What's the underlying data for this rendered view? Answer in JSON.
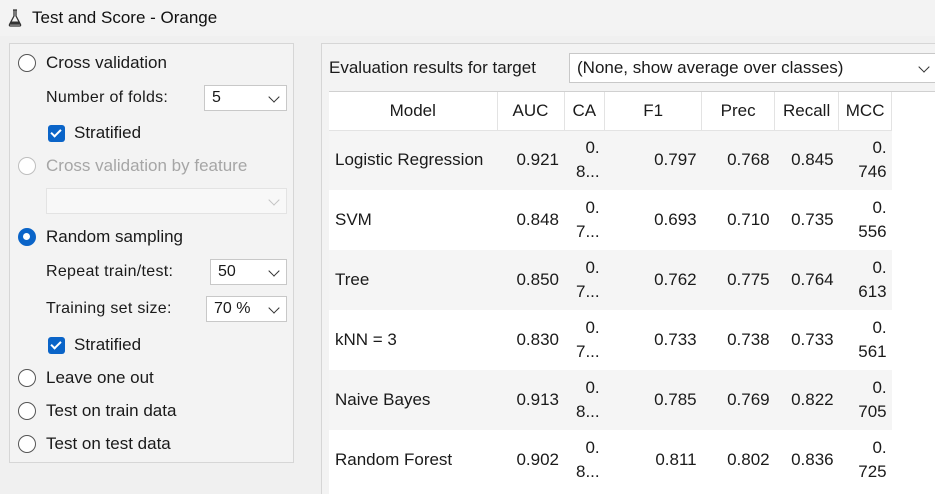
{
  "window": {
    "title": "Test and Score - Orange",
    "icon": "flask-icon"
  },
  "sampling": {
    "cross_validation": {
      "label": "Cross validation",
      "checked": false
    },
    "folds_label": "Number of folds:",
    "folds_value": "5",
    "stratified_1": {
      "label": "Stratified",
      "checked": true
    },
    "cv_by_feature": {
      "label": "Cross validation by feature",
      "enabled": false
    },
    "feature_value": "",
    "random_sampling": {
      "label": "Random sampling",
      "checked": true
    },
    "repeat_label": "Repeat train/test:",
    "repeat_value": "50",
    "training_label": "Training set size:",
    "training_value": "70 %",
    "stratified_2": {
      "label": "Stratified",
      "checked": true
    },
    "leave_one_out": {
      "label": "Leave one out",
      "checked": false
    },
    "test_on_train": {
      "label": "Test on train data",
      "checked": false
    },
    "test_on_test": {
      "label": "Test on test data",
      "checked": false
    }
  },
  "evaluation": {
    "target_label": "Evaluation results for target",
    "target_value": "(None, show average over classes)"
  },
  "table": {
    "columns": [
      "Model",
      "AUC",
      "CA",
      "F1",
      "Prec",
      "Recall",
      "MCC"
    ],
    "rows": [
      {
        "model": "Logistic Regression",
        "auc": "0.921",
        "ca_1": "0.",
        "ca_2": "8...",
        "f1": "0.797",
        "prec": "0.768",
        "recall": "0.845",
        "mcc_1": "0.",
        "mcc_2": "746"
      },
      {
        "model": "SVM",
        "auc": "0.848",
        "ca_1": "0.",
        "ca_2": "7...",
        "f1": "0.693",
        "prec": "0.710",
        "recall": "0.735",
        "mcc_1": "0.",
        "mcc_2": "556"
      },
      {
        "model": "Tree",
        "auc": "0.850",
        "ca_1": "0.",
        "ca_2": "7...",
        "f1": "0.762",
        "prec": "0.775",
        "recall": "0.764",
        "mcc_1": "0.",
        "mcc_2": "613"
      },
      {
        "model": "kNN = 3",
        "auc": "0.830",
        "ca_1": "0.",
        "ca_2": "7...",
        "f1": "0.733",
        "prec": "0.738",
        "recall": "0.733",
        "mcc_1": "0.",
        "mcc_2": "561"
      },
      {
        "model": "Naive Bayes",
        "auc": "0.913",
        "ca_1": "0.",
        "ca_2": "8...",
        "f1": "0.785",
        "prec": "0.769",
        "recall": "0.822",
        "mcc_1": "0.",
        "mcc_2": "705"
      },
      {
        "model": "Random Forest",
        "auc": "0.902",
        "ca_1": "0.",
        "ca_2": "8...",
        "f1": "0.811",
        "prec": "0.802",
        "recall": "0.836",
        "mcc_1": "0.",
        "mcc_2": "725"
      }
    ]
  },
  "colors": {
    "accent": "#0a64c8",
    "alt_row": "#f5f5f5"
  }
}
